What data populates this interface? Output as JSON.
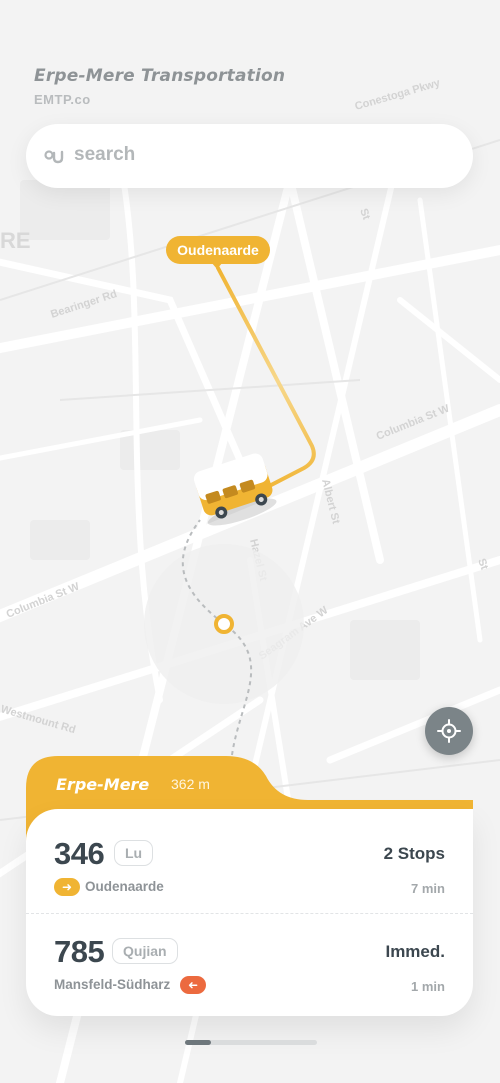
{
  "header": {
    "title": "Erpe-Mere Transportation",
    "subtitle": "EMTP.co"
  },
  "search": {
    "placeholder": "search",
    "icon": "search-icon"
  },
  "map": {
    "street_labels": [
      "Conestoga Pkwy",
      "Bearinger Rd",
      "Columbia St W",
      "Columbia St W",
      "Albert St",
      "Westmount Rd",
      "Hazel St",
      "Seagram Ave W",
      "St",
      "St",
      "RE"
    ],
    "destination_pin": "Oudenaarde",
    "route_color": "#f0b433",
    "vehicle": "bus-icon",
    "locate_icon": "crosshair-icon"
  },
  "sheet": {
    "stop_name": "Erpe-Mere",
    "distance": "362 m",
    "accent": "#f0b433",
    "routes": [
      {
        "number": "346",
        "badge": "Lu",
        "direction_icon": "arrow-right-icon",
        "direction_color": "#f0b433",
        "destination": "Oudenaarde",
        "status": "2 Stops",
        "time": "7 min"
      },
      {
        "number": "785",
        "badge": "Qujian",
        "direction_icon": "arrow-left-icon",
        "direction_color": "#ec6a3f",
        "destination": "Mansfeld-Südharz",
        "status": "Immed.",
        "time": "1 min"
      }
    ]
  },
  "pager": {
    "active_fraction": 0.2
  }
}
